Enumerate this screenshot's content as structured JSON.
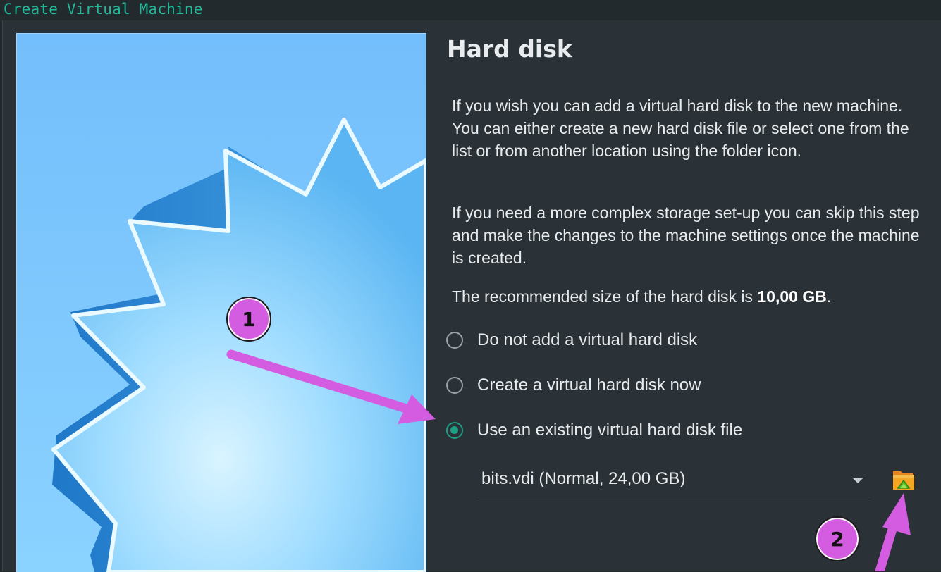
{
  "window": {
    "title": "Create Virtual Machine"
  },
  "page": {
    "heading": "Hard disk",
    "paragraph1": "If you wish you can add a virtual hard disk to the new machine. You can either create a new hard disk file or select one from the list or from another location using the folder icon.",
    "paragraph2": "If you need a more complex storage set-up you can skip this step and make the changes to the machine settings once the machine is created.",
    "recommended_prefix": "The recommended size of the hard disk is ",
    "recommended_size": "10,00 GB",
    "recommended_suffix": "."
  },
  "options": [
    {
      "label": "Do not add a virtual hard disk",
      "checked": false
    },
    {
      "label": "Create a virtual hard disk now",
      "checked": false
    },
    {
      "label": "Use an existing virtual hard disk file",
      "checked": true
    }
  ],
  "disk_select": {
    "value": "bits.vdi (Normal, 24,00 GB)"
  },
  "icons": {
    "folder_button": "folder-open-icon",
    "dropdown": "chevron-down-icon"
  },
  "annotations": {
    "badge1": "1",
    "badge2": "2",
    "color": "#d45ce0"
  }
}
